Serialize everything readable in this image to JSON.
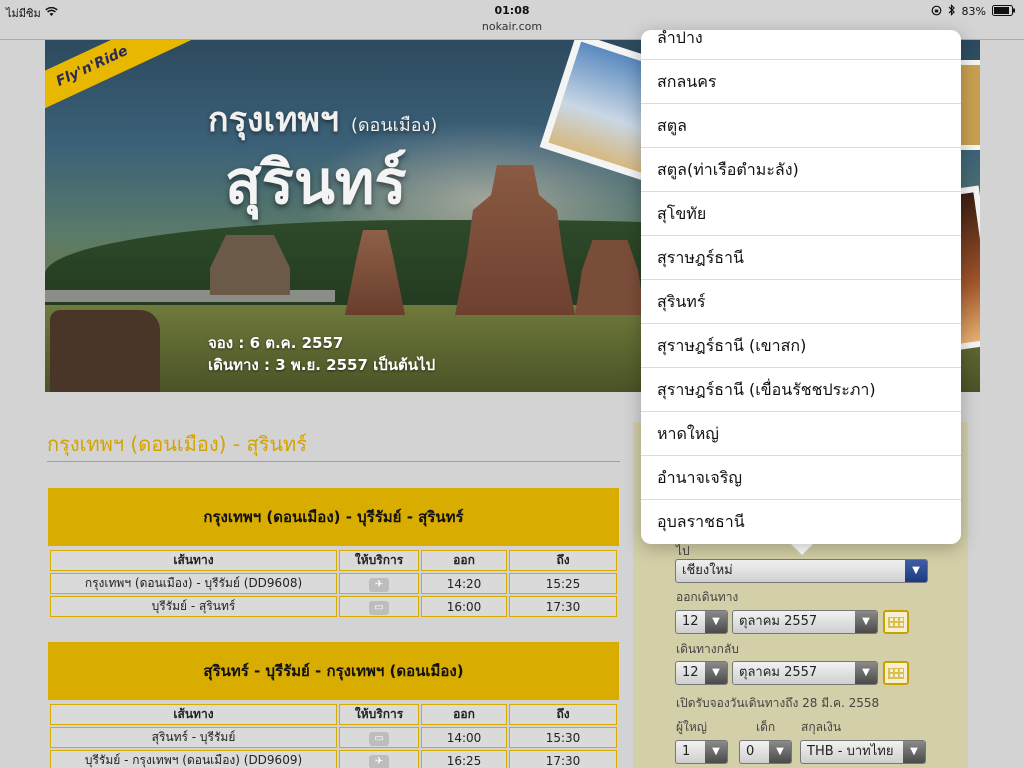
{
  "status_bar": {
    "carrier": "ไม่มีซิม",
    "time": "01:08",
    "battery": "83%"
  },
  "url_bar": {
    "url": "nokair.com"
  },
  "banner": {
    "ribbon": "Fly'n'Ride",
    "title_line1": "กรุงเทพฯ",
    "title_line1_sub": "(ดอนเมือง)",
    "title_line2": "สุรินทร์",
    "booking_line": "จอง : 6 ต.ค. 2557",
    "travel_line": "เดินทาง :  3 พ.ย. 2557 เป็นต้นไป"
  },
  "route_heading": "กรุงเทพฯ (ดอนเมือง) - สุรินทร์",
  "schedules": [
    {
      "title": "กรุงเทพฯ (ดอนเมือง) - บุรีรัมย์ - สุรินทร์",
      "columns": [
        "เส้นทาง",
        "ให้บริการ",
        "ออก",
        "ถึง"
      ],
      "rows": [
        {
          "route": "กรุงเทพฯ (ดอนเมือง) - บุรีรัมย์ (DD9608)",
          "service": "plane",
          "depart": "14:20",
          "arrive": "15:25"
        },
        {
          "route": "บุรีรัมย์ - สุรินทร์",
          "service": "bus",
          "depart": "16:00",
          "arrive": "17:30"
        }
      ]
    },
    {
      "title": "สุรินทร์ - บุรีรัมย์ - กรุงเทพฯ (ดอนเมือง)",
      "columns": [
        "เส้นทาง",
        "ให้บริการ",
        "ออก",
        "ถึง"
      ],
      "rows": [
        {
          "route": "สุรินทร์ - บุรีรัมย์",
          "service": "bus",
          "depart": "14:00",
          "arrive": "15:30"
        },
        {
          "route": "บุรีรัมย์ - กรุงเทพฯ (ดอนเมือง) (DD9609)",
          "service": "plane",
          "depart": "16:25",
          "arrive": "17:30"
        }
      ]
    }
  ],
  "booking_form": {
    "to_label": "ไป",
    "to_value": "เชียงใหม่",
    "depart_label": "ออกเดินทาง",
    "depart_day": "12",
    "depart_month": "ตุลาคม 2557",
    "return_label": "เดินทางกลับ",
    "return_day": "12",
    "return_month": "ตุลาคม 2557",
    "open_note": "เปิดรับจองวันเดินทางถึง 28 มี.ค. 2558",
    "adult_label": "ผู้ใหญ่",
    "adult_value": "1",
    "child_label": "เด็ก",
    "child_value": "0",
    "currency_label": "สกุลเงิน",
    "currency_value": "THB - บาทไทย"
  },
  "dropdown_options": [
    "ลำปาง",
    "สกลนคร",
    "สตูล",
    "สตูล(ท่าเรือตำมะลัง)",
    "สุโขทัย",
    "สุราษฎร์ธานี",
    "สุรินทร์",
    "สุราษฎร์ธานี (เขาสก)",
    "สุราษฎร์ธานี (เขื่อนรัชชประภา)",
    "หาดใหญ่",
    "อำนาจเจริญ",
    "อุบลราชธานี"
  ],
  "colors": {
    "accent": "#d9ad00",
    "page_bg": "#d3d3d3",
    "form_bg": "#d3cfa8"
  }
}
